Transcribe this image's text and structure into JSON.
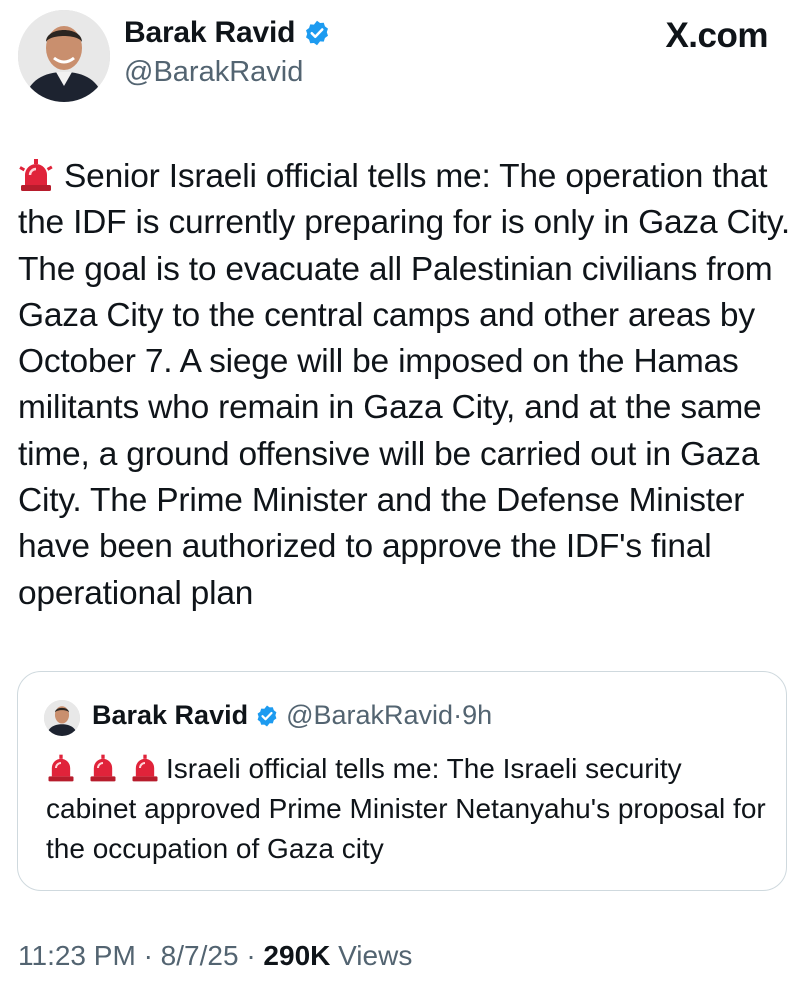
{
  "author": {
    "name": "Barak Ravid",
    "handle": "@BarakRavid",
    "verified": true
  },
  "brand": "X.com",
  "tweet": {
    "text": "Senior Israeli official tells me: The operation that the IDF is currently preparing for is only in Gaza City. The goal is to evacuate all Palestinian civilians from Gaza City to the central camps and other areas by October 7. A siege will be imposed on the Hamas militants who remain in Gaza City, and at the same time, a ground offensive will be carried out in Gaza City. The Prime Minister and the Defense Minister have been authorized to approve the IDF's final operational plan",
    "leading_icon": "rotating-light-icon"
  },
  "quote": {
    "name": "Barak Ravid",
    "handle": "@BarakRavid",
    "separator": "·",
    "time": "9h",
    "icons": [
      "rotating-light-icon",
      "rotating-light-icon",
      "rotating-light-icon"
    ],
    "text": "Israeli official tells me: The Israeli security cabinet approved Prime Minister Netanyahu's proposal for the occupation of Gaza city"
  },
  "footer": {
    "time": "11:23 PM",
    "sep1": "·",
    "date": "8/7/25",
    "sep2": "·",
    "views_count": "290K",
    "views_label": "Views"
  },
  "colors": {
    "text": "#0f1419",
    "secondary": "#536471",
    "verified": "#1d9bf0",
    "border": "#cfd9de",
    "siren": "#e0233a"
  }
}
